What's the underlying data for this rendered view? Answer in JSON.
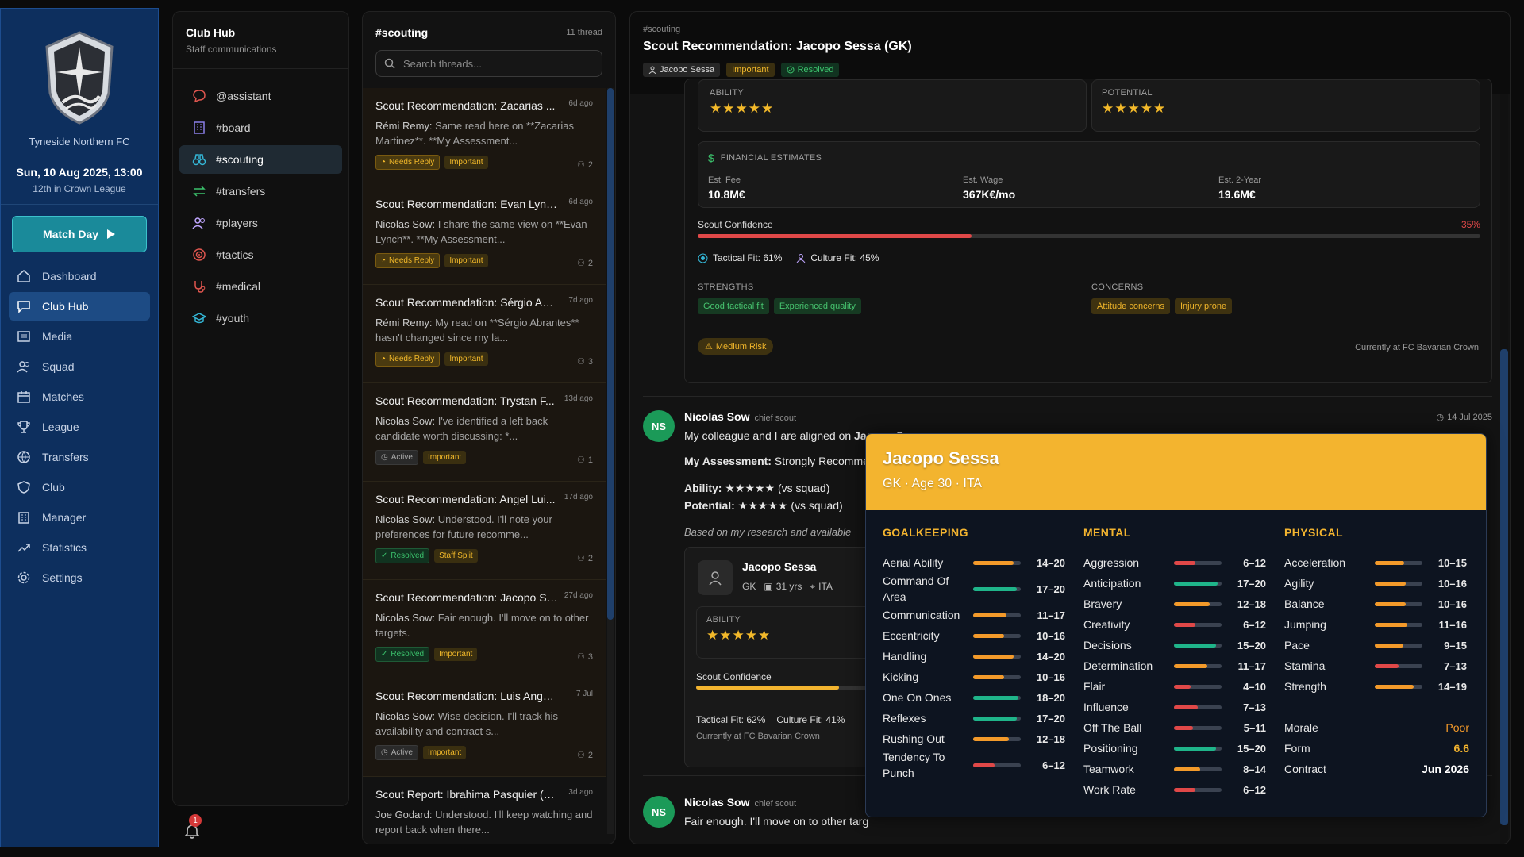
{
  "colors": {
    "nav_bg": "#0d2f5e",
    "accent": "#1a8a9a",
    "gold": "#f3b42f",
    "green": "#1b9a58",
    "red": "#e04848"
  },
  "club": {
    "name": "Tyneside Northern FC",
    "date": "Sun, 10 Aug 2025, 13:00",
    "league_pos": "12th in Crown League",
    "match_day": "Match Day"
  },
  "nav": [
    {
      "label": "Dashboard",
      "icon": "home-icon"
    },
    {
      "label": "Club Hub",
      "icon": "chat-icon",
      "active": true
    },
    {
      "label": "Media",
      "icon": "newspaper-icon"
    },
    {
      "label": "Squad",
      "icon": "users-icon"
    },
    {
      "label": "Matches",
      "icon": "calendar-icon"
    },
    {
      "label": "League",
      "icon": "trophy-icon"
    },
    {
      "label": "Transfers",
      "icon": "globe-icon"
    },
    {
      "label": "Club",
      "icon": "shield-icon"
    },
    {
      "label": "Manager",
      "icon": "building-icon"
    },
    {
      "label": "Statistics",
      "icon": "trend-icon"
    },
    {
      "label": "Settings",
      "icon": "gear-icon"
    }
  ],
  "hub": {
    "title": "Club Hub",
    "subtitle": "Staff communications",
    "notifications": "1"
  },
  "channels": [
    {
      "label": "@assistant",
      "icon": "message-icon",
      "color": "#e0564f"
    },
    {
      "label": "#board",
      "icon": "building-icon",
      "color": "#8b7fe8"
    },
    {
      "label": "#scouting",
      "icon": "binoculars-icon",
      "color": "#34b6d6",
      "active": true
    },
    {
      "label": "#transfers",
      "icon": "swap-icon",
      "color": "#3bc26c"
    },
    {
      "label": "#players",
      "icon": "users-icon",
      "color": "#c0a6ff"
    },
    {
      "label": "#tactics",
      "icon": "target-icon",
      "color": "#e0564f"
    },
    {
      "label": "#medical",
      "icon": "stethoscope-icon",
      "color": "#e0564f"
    },
    {
      "label": "#youth",
      "icon": "graduation-icon",
      "color": "#34b6d6"
    }
  ],
  "threads": {
    "title": "#scouting",
    "count": "11 thread",
    "search_placeholder": "Search threads...",
    "items": [
      {
        "title": "Scout Recommendation: Zacarias ...",
        "age": "6d ago",
        "author": "Rémi Remy:",
        "preview": " Same read here on **Zacarias Martinez**. **My Assessment...",
        "status": "Needs Reply",
        "priority": "Important",
        "participants": "2"
      },
      {
        "title": "Scout Recommendation: Evan Lync...",
        "age": "6d ago",
        "author": "Nicolas Sow:",
        "preview": " I share the same view on **Evan Lynch**. **My Assessment...",
        "status": "Needs Reply",
        "priority": "Important",
        "participants": "2"
      },
      {
        "title": "Scout Recommendation: Sérgio Abr...",
        "age": "7d ago",
        "author": "Rémi Remy:",
        "preview": " My read on **Sérgio Abrantes** hasn't changed since my la...",
        "status": "Needs Reply",
        "priority": "Important",
        "participants": "3"
      },
      {
        "title": "Scout Recommendation: Trystan F...",
        "age": "13d ago",
        "author": "Nicolas Sow:",
        "preview": " I've identified a left back candidate worth discussing: *...",
        "status": "Active",
        "priority": "Important",
        "participants": "1"
      },
      {
        "title": "Scout Recommendation: Angel Lui...",
        "age": "17d ago",
        "author": "Nicolas Sow:",
        "preview": " Understood. I'll note your preferences for future recomme...",
        "status": "Resolved",
        "priority": "Staff Split",
        "participants": "2"
      },
      {
        "title": "Scout Recommendation: Jacopo Se...",
        "age": "27d ago",
        "author": "Nicolas Sow:",
        "preview": " Fair enough. I'll move on to other targets.",
        "status": "Resolved",
        "priority": "Important",
        "participants": "3"
      },
      {
        "title": "Scout Recommendation: Luis Angel B...",
        "age": "7 Jul",
        "author": "Nicolas Sow:",
        "preview": " Wise decision. I'll track his availability and contract s...",
        "status": "Active",
        "priority": "Important",
        "participants": "2"
      },
      {
        "title": "Scout Report: Ibrahima Pasquier (RB)",
        "age": "3d ago",
        "author": "Joe Godard:",
        "preview": " Understood. I'll keep watching and report back when there...",
        "status": "",
        "priority": "",
        "participants": ""
      }
    ]
  },
  "conversation": {
    "channel": "#scouting",
    "title": "Scout Recommendation: Jacopo Sessa (GK)",
    "tags": {
      "player": "Jacopo Sessa",
      "priority": "Important",
      "status": "Resolved"
    },
    "report": {
      "ability_label": "ABILITY",
      "potential_label": "POTENTIAL",
      "ability_stars": "★★★★★",
      "potential_stars": "★★★★★",
      "fin_title": "FINANCIAL ESTIMATES",
      "fee_label": "Est. Fee",
      "fee": "10.8M€",
      "wage_label": "Est. Wage",
      "wage": "367K€/mo",
      "total_label": "Est. 2-Year",
      "total": "19.6M€",
      "conf_label": "Scout Confidence",
      "conf": "35%",
      "conf_value": 0.35,
      "tactical": "Tactical Fit: 61%",
      "culture": "Culture Fit: 45%",
      "strengths_label": "STRENGTHS",
      "strengths": [
        "Good tactical fit",
        "Experienced quality"
      ],
      "concerns_label": "CONCERNS",
      "concerns": [
        "Attitude concerns",
        "Injury prone"
      ],
      "risk": "Medium Risk",
      "current": "Currently at FC Bavarian Crown"
    },
    "msg1": {
      "initials": "NS",
      "name": "Nicolas Sow",
      "role": "chief scout",
      "date": "14 Jul 2025",
      "line1_pre": "My colleague and I are aligned on ",
      "line1_bold": "Jacopo Sessa",
      ".": ".",
      "line1_end": ".",
      "assess_label": "My Assessment:",
      "assess_text": " Strongly Recomme",
      "ability_label": "Ability:",
      "ability_stars": "★★★★★",
      "ability_suffix": " (vs squad)",
      "potential_label": "Potential:",
      "potential_stars": "★★★★★",
      "potential_suffix": " (vs squad)",
      "research": "Based on my research and available",
      "card": {
        "name": "Jacopo Sessa",
        "pos": "GK",
        "age": "31 yrs",
        "nation": "ITA",
        "ability_label": "ABILITY",
        "stars": "★★★★★",
        "conf_label": "Scout Confidence",
        "conf_value": 0.62,
        "tactical": "Tactical Fit: 62%",
        "culture": "Culture Fit: 41%",
        "current": "Currently at FC Bavarian Crown"
      }
    },
    "msg2": {
      "initials": "NS",
      "name": "Nicolas Sow",
      "role": "chief scout",
      "text": "Fair enough. I'll move on to other targ"
    }
  },
  "popup": {
    "name": "Jacopo Sessa",
    "meta": "GK · Age 30 · ITA",
    "gk_title": "GOALKEEPING",
    "mental_title": "MENTAL",
    "physical_title": "PHYSICAL",
    "goalkeeping": [
      {
        "name": "Aerial Ability",
        "range": "14–20",
        "level": 0.85,
        "color": "#f39a2a"
      },
      {
        "name": "Command Of Area",
        "range": "17–20",
        "level": 0.92,
        "color": "#1fb58a"
      },
      {
        "name": "Communication",
        "range": "11–17",
        "level": 0.7,
        "color": "#f39a2a"
      },
      {
        "name": "Eccentricity",
        "range": "10–16",
        "level": 0.65,
        "color": "#f39a2a"
      },
      {
        "name": "Handling",
        "range": "14–20",
        "level": 0.85,
        "color": "#f39a2a"
      },
      {
        "name": "Kicking",
        "range": "10–16",
        "level": 0.65,
        "color": "#f39a2a"
      },
      {
        "name": "One On Ones",
        "range": "18–20",
        "level": 0.95,
        "color": "#1fb58a"
      },
      {
        "name": "Reflexes",
        "range": "17–20",
        "level": 0.92,
        "color": "#1fb58a"
      },
      {
        "name": "Rushing Out",
        "range": "12–18",
        "level": 0.75,
        "color": "#f39a2a"
      },
      {
        "name": "Tendency To Punch",
        "range": "6–12",
        "level": 0.45,
        "color": "#e04848"
      }
    ],
    "mental": [
      {
        "name": "Aggression",
        "range": "6–12",
        "level": 0.45,
        "color": "#e04848"
      },
      {
        "name": "Anticipation",
        "range": "17–20",
        "level": 0.92,
        "color": "#1fb58a"
      },
      {
        "name": "Bravery",
        "range": "12–18",
        "level": 0.75,
        "color": "#f39a2a"
      },
      {
        "name": "Creativity",
        "range": "6–12",
        "level": 0.45,
        "color": "#e04848"
      },
      {
        "name": "Decisions",
        "range": "15–20",
        "level": 0.88,
        "color": "#1fb58a"
      },
      {
        "name": "Determination",
        "range": "11–17",
        "level": 0.7,
        "color": "#f39a2a"
      },
      {
        "name": "Flair",
        "range": "4–10",
        "level": 0.35,
        "color": "#e04848"
      },
      {
        "name": "Influence",
        "range": "7–13",
        "level": 0.5,
        "color": "#e04848"
      },
      {
        "name": "Off The Ball",
        "range": "5–11",
        "level": 0.4,
        "color": "#e04848"
      },
      {
        "name": "Positioning",
        "range": "15–20",
        "level": 0.88,
        "color": "#1fb58a"
      },
      {
        "name": "Teamwork",
        "range": "8–14",
        "level": 0.55,
        "color": "#f39a2a"
      },
      {
        "name": "Work Rate",
        "range": "6–12",
        "level": 0.45,
        "color": "#e04848"
      }
    ],
    "physical": [
      {
        "name": "Acceleration",
        "range": "10–15",
        "level": 0.62,
        "color": "#f39a2a"
      },
      {
        "name": "Agility",
        "range": "10–16",
        "level": 0.65,
        "color": "#f39a2a"
      },
      {
        "name": "Balance",
        "range": "10–16",
        "level": 0.65,
        "color": "#f39a2a"
      },
      {
        "name": "Jumping",
        "range": "11–16",
        "level": 0.68,
        "color": "#f39a2a"
      },
      {
        "name": "Pace",
        "range": "9–15",
        "level": 0.6,
        "color": "#f39a2a"
      },
      {
        "name": "Stamina",
        "range": "7–13",
        "level": 0.5,
        "color": "#e04848"
      },
      {
        "name": "Strength",
        "range": "14–19",
        "level": 0.82,
        "color": "#f39a2a"
      }
    ],
    "morale_label": "Morale",
    "morale": "Poor",
    "form_label": "Form",
    "form": "6.6",
    "contract_label": "Contract",
    "contract": "Jun 2026"
  }
}
